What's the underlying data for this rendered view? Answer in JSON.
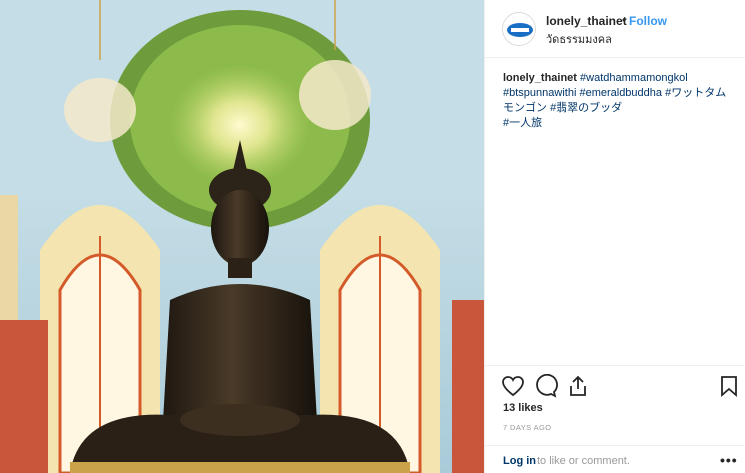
{
  "post": {
    "username": "lonely_thainet",
    "follow_label": "Follow",
    "separator": "•",
    "location": "วัดธรรมมงคล",
    "caption": {
      "username": "lonely_thainet",
      "hashtags": [
        "#watdhammamongkol",
        "#btspunnawithi",
        "#emeraldbuddha",
        "#ワットタムモンゴン",
        "#翡翠のブッダ",
        "#一人旅"
      ]
    },
    "likes": "13 likes",
    "date": "7 DAYS AGO",
    "comment": {
      "login_label": "Log in",
      "rest_text": "to like or comment.",
      "more_label": "•••"
    }
  },
  "icons": [
    "heart-icon",
    "comment-icon",
    "share-icon",
    "bookmark-icon"
  ],
  "colors": {
    "link": "#003569",
    "follow": "#3897f0",
    "muted": "#999999"
  }
}
